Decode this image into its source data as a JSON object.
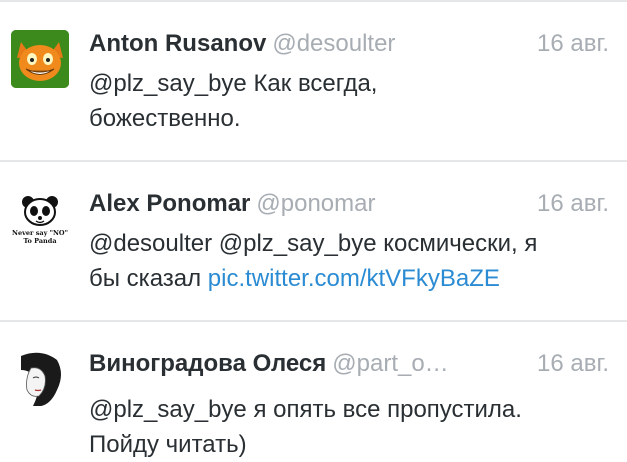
{
  "tweets": [
    {
      "name": "Anton Rusanov",
      "handle": "@desoulter",
      "time": "16 авг.",
      "line1": "@plz_say_bye Как всегда,",
      "line2": "божественно.",
      "avatar_icon": "orange-cat-avatar-icon"
    },
    {
      "name": "Alex Ponomar",
      "handle": "@ponomar",
      "time": "16 авг.",
      "line1": "@desoulter @plz_say_bye космически, я",
      "line2_text": "бы сказал ",
      "line2_link": "pic.twitter.com/ktVFkyBaZE",
      "avatar_icon": "panda-avatar-icon",
      "avatar_caption_line1": "Never say \"NO\"",
      "avatar_caption_line2": "To Panda"
    },
    {
      "name": "Виноградова Олеся",
      "handle": "@part_o…",
      "time": "16 авг.",
      "line1": "@plz_say_bye я опять все пропустила.",
      "line2": "Пойду читать)",
      "avatar_icon": "girl-sketch-avatar-icon"
    }
  ],
  "colors": {
    "link": "#2b8bd3",
    "text": "#292f33",
    "muted": "#a7adb3",
    "separator": "#e4e6e8"
  }
}
